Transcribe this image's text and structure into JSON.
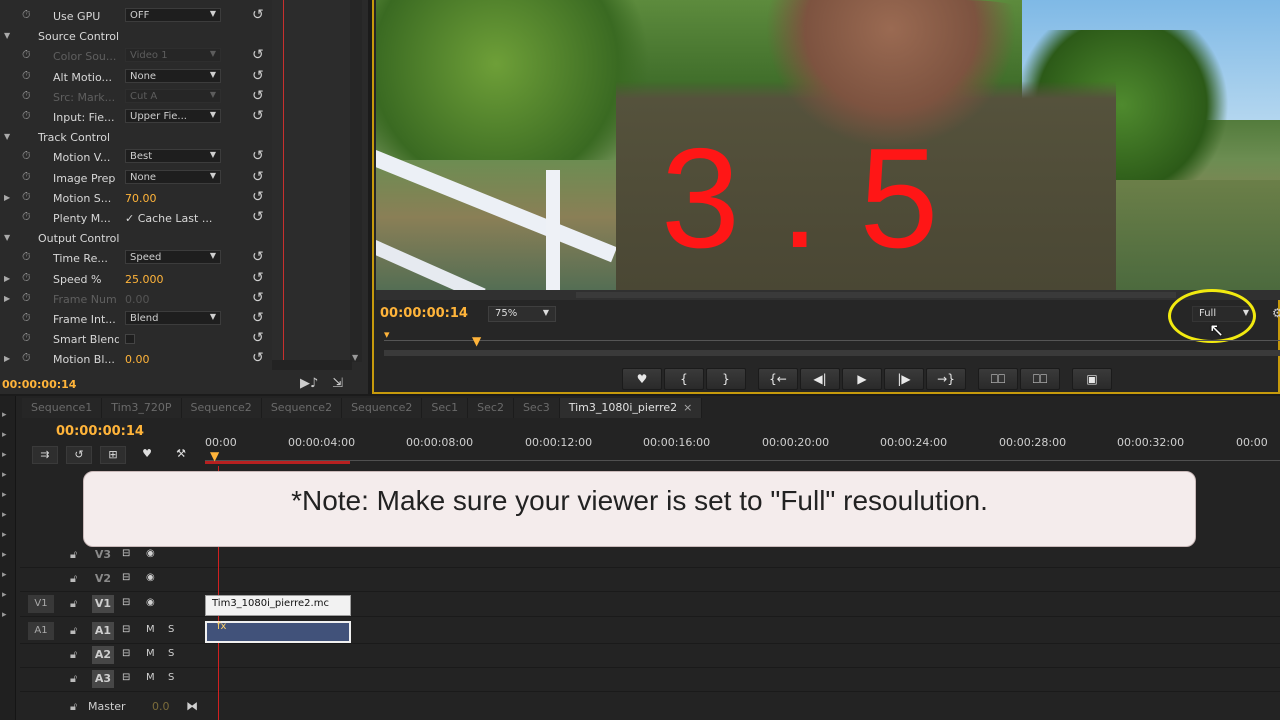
{
  "effect_controls": {
    "rows": [
      {
        "label": "Use GPU",
        "control": "OFF",
        "kind": "drop"
      },
      {
        "label": "Source Control",
        "kind": "header"
      },
      {
        "label": "Color Sou...",
        "control": "Video 1",
        "kind": "drop",
        "dim": true
      },
      {
        "label": "Alt Motio...",
        "control": "None",
        "kind": "drop"
      },
      {
        "label": "Src: Mark...",
        "control": "Cut A",
        "kind": "drop",
        "dim": true
      },
      {
        "label": "Input: Fie...",
        "control": "Upper Fie...",
        "kind": "drop"
      },
      {
        "label": "Track Control",
        "kind": "header"
      },
      {
        "label": "Motion V...",
        "control": "Best",
        "kind": "drop"
      },
      {
        "label": "Image Prep",
        "control": "None",
        "kind": "drop"
      },
      {
        "label": "Motion S...",
        "control": "70.00",
        "kind": "value"
      },
      {
        "label": "Plenty M...",
        "control": "✓ Cache Last ...",
        "kind": "check"
      },
      {
        "label": "Output Control",
        "kind": "header"
      },
      {
        "label": "Time Re...",
        "control": "Speed",
        "kind": "drop"
      },
      {
        "label": "Speed %",
        "control": "25.000",
        "kind": "value"
      },
      {
        "label": "Frame Num",
        "control": "0.00",
        "kind": "value",
        "dim": true
      },
      {
        "label": "Frame Int...",
        "control": "Blend",
        "kind": "drop"
      },
      {
        "label": "Smart Blend",
        "control": "",
        "kind": "box"
      },
      {
        "label": "Motion Bl...",
        "control": "0.00",
        "kind": "value"
      }
    ],
    "timecode": "00:00:00:14"
  },
  "program_monitor": {
    "overlay_text": "3.5",
    "timecode": "00:00:00:14",
    "zoom": "75%",
    "resolution": "Full"
  },
  "transport": {
    "buttons": [
      "♥",
      "{",
      "}",
      "{←",
      "◀|",
      "▶",
      "|▶",
      "→}",
      "⎕⎕",
      "⎕⎕",
      "▣"
    ]
  },
  "timeline": {
    "tabs": [
      "Sequence1",
      "Tim3_720P",
      "Sequence2",
      "Sequence2",
      "Sequence2",
      "Sec1",
      "Sec2",
      "Sec3",
      "Tim3_1080i_pierre2"
    ],
    "active_tab": "Tim3_1080i_pierre2",
    "timecode": "00:00:00:14",
    "ruler": [
      "00:00",
      "00:00:04:00",
      "00:00:08:00",
      "00:00:12:00",
      "00:00:16:00",
      "00:00:20:00",
      "00:00:24:00",
      "00:00:28:00",
      "00:00:32:00",
      "00:00"
    ],
    "note": "*Note: Make sure your viewer is set to \"Full\" resoulution.",
    "tracks": {
      "v3": "V3",
      "v2": "V2",
      "v1_src": "V1",
      "v1": "V1",
      "a1_src": "A1",
      "a1": "A1",
      "a2": "A2",
      "a3": "A3",
      "m": "M",
      "s": "S",
      "master": "Master",
      "master_value": "0.0"
    },
    "clip_name": "Tim3_1080i_pierre2.mc",
    "clip_fx": "fx"
  }
}
